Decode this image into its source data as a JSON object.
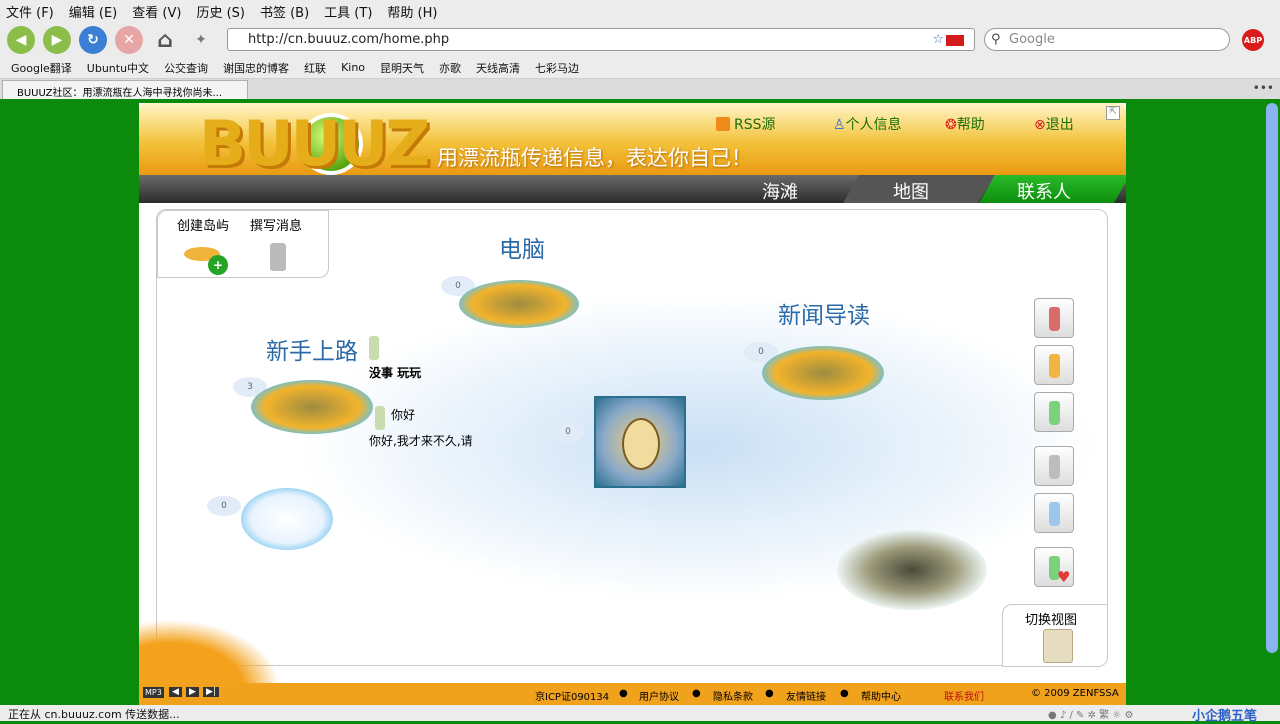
{
  "menu": [
    "文件 (F)",
    "编辑 (E)",
    "查看 (V)",
    "历史 (S)",
    "书签 (B)",
    "工具 (T)",
    "帮助 (H)"
  ],
  "url": "http://cn.buuuz.com/home.php",
  "search_placeholder": "Google",
  "abp_label": "ABP",
  "bookmarks": [
    "Google翻译",
    "Ubuntu中文",
    "公交查询",
    "谢国忠的博客",
    "红联",
    "Kino",
    "昆明天气",
    "亦歌",
    "天线高清",
    "七彩马边"
  ],
  "tab_title": "BUUUZ社区：用漂流瓶在人海中寻找你尚未...",
  "site": {
    "logo": "BUUUZ",
    "slogan": "用漂流瓶传递信息，表达你自己！",
    "links": {
      "rss": "RSS源",
      "profile": "个人信息",
      "help": "帮助",
      "logout": "退出"
    },
    "nav": {
      "beach": "海滩",
      "map": "地图",
      "contacts": "联系人"
    }
  },
  "toolbox": {
    "create_island": "创建岛屿",
    "compose": "撰写消息"
  },
  "map": {
    "islands": {
      "computer": {
        "title": "电脑",
        "count": "0"
      },
      "newbie": {
        "title": "新手上路",
        "count": "3"
      },
      "news": {
        "title": "新闻导读",
        "count": "0"
      },
      "center": {
        "count": "0"
      },
      "ice": {
        "count": "0"
      }
    },
    "messages": {
      "msg1": "没事 玩玩",
      "msg2": "你好",
      "msg3": "你好,我才来不久,请"
    },
    "switch_view": "切换视图"
  },
  "footer": {
    "mp3": "MP3",
    "icp": "京ICP证090134",
    "terms": "用户协议",
    "privacy": "隐私条款",
    "links": "友情链接",
    "helpcenter": "帮助中心",
    "contact": "联系我们",
    "copyright": "© 2009 ZENFSSA"
  },
  "status_text": "正在从 cn.buuuz.com 传送数据...",
  "tray_brand": "小企鹅五笔",
  "colors": {
    "page_bg": "#0b8a0b",
    "banner": "#f3c23a",
    "map_title": "#2a6aa8",
    "link_green": "#1b6f08"
  }
}
